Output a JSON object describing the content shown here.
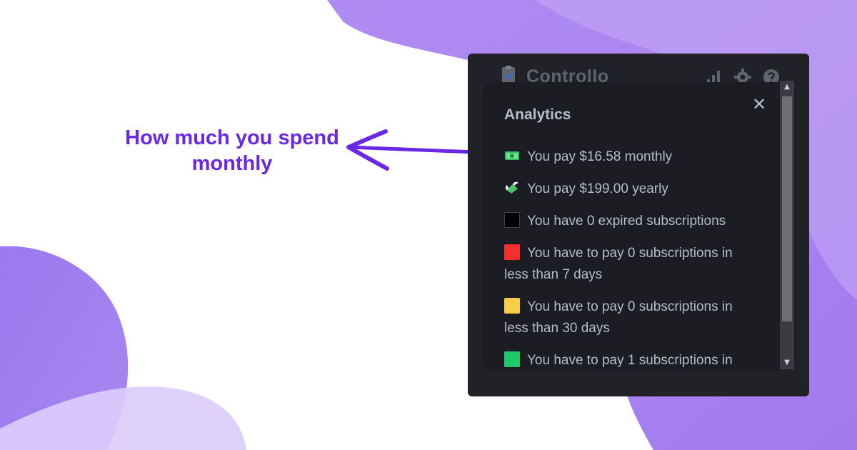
{
  "callout": {
    "line1": "How much you spend",
    "line2": "monthly"
  },
  "app": {
    "title": "Controllo",
    "icons": [
      "clipboard-check-icon",
      "bar-chart-icon",
      "gear-icon",
      "question-circle-icon"
    ]
  },
  "modal": {
    "title": "Analytics",
    "close_label": "✕",
    "stats": [
      {
        "icon": "money-bill-icon",
        "text": "You pay $16.58 monthly"
      },
      {
        "icon": "money-with-wings-icon",
        "text": "You pay $199.00 yearly"
      },
      {
        "icon": "black-square-icon",
        "text": "You have 0 expired subscriptions"
      },
      {
        "icon": "red-square-icon",
        "text": "You have to pay 0 subscriptions in less than 7 days"
      },
      {
        "icon": "yellow-square-icon",
        "text": "You have to pay 0 subscriptions in less than 30 days"
      },
      {
        "icon": "green-square-icon",
        "text": "You have to pay 1 subscriptions in"
      }
    ]
  },
  "scrollbar": {
    "up": "▲",
    "down": "▼"
  },
  "colors": {
    "accent": "#6a28e6",
    "blob_purple": "#a57ef0",
    "window_bg": "#202228",
    "modal_bg": "#1b1d22",
    "text": "#b7bcc6",
    "red": "#f2302f",
    "yellow": "#f7ce45",
    "green": "#1ec96a"
  }
}
